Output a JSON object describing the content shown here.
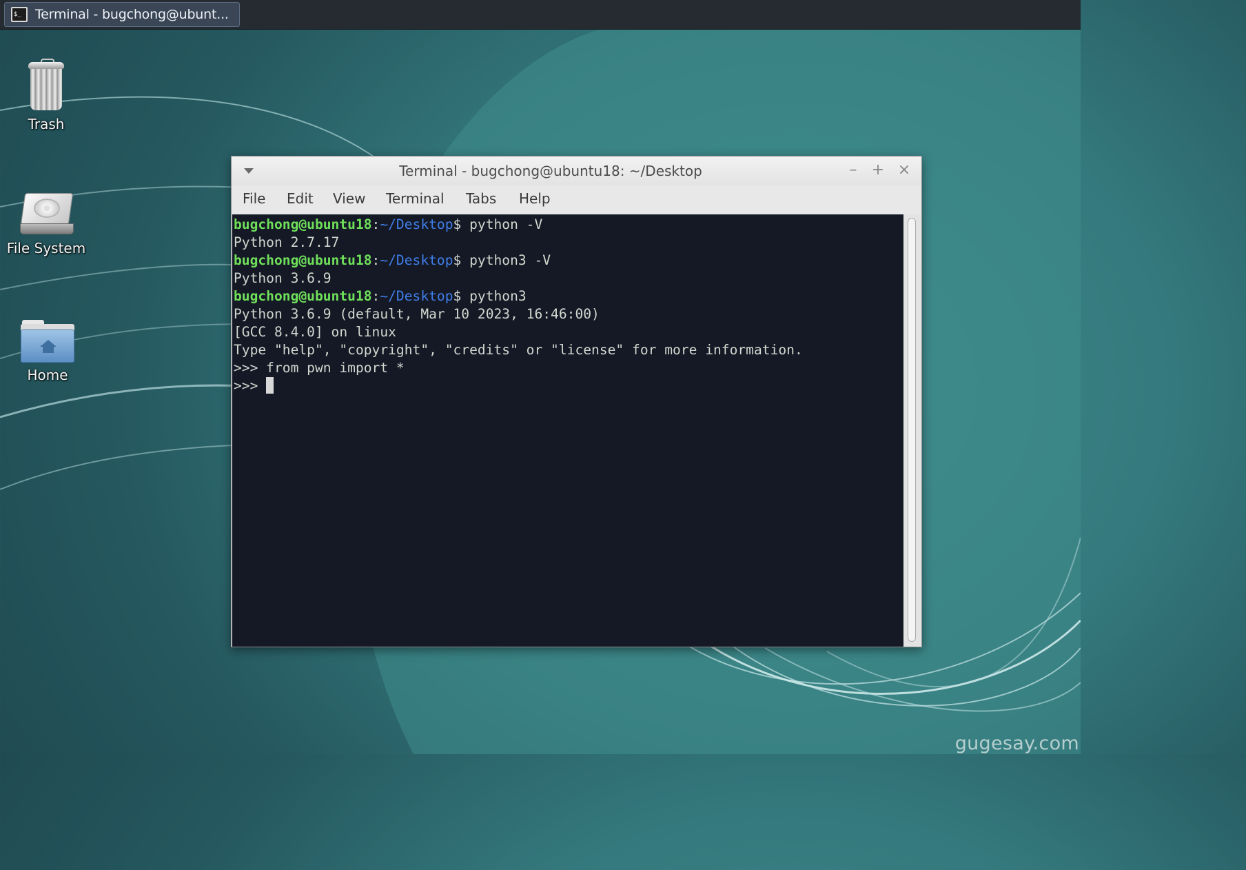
{
  "taskbar": {
    "window_button_label": "Terminal - bugchong@ubunt...",
    "window_icon": "terminal-icon"
  },
  "desktop": {
    "icons": [
      {
        "label": "Trash",
        "icon": "trash-icon"
      },
      {
        "label": "File System",
        "icon": "hard-drive-icon"
      },
      {
        "label": "Home",
        "icon": "home-folder-icon"
      }
    ]
  },
  "window": {
    "title": "Terminal - bugchong@ubuntu18: ~/Desktop",
    "controls": {
      "minimize": "–",
      "maximize": "+",
      "close": "×"
    },
    "menu": [
      "File",
      "Edit",
      "View",
      "Terminal",
      "Tabs",
      "Help"
    ]
  },
  "terminal": {
    "user_host": "bugchong@ubuntu18",
    "path": "~/Desktop",
    "lines": [
      {
        "type": "prompt",
        "command": "python -V"
      },
      {
        "type": "output",
        "text": "Python 2.7.17"
      },
      {
        "type": "prompt",
        "command": "python3 -V"
      },
      {
        "type": "output",
        "text": "Python 3.6.9"
      },
      {
        "type": "prompt",
        "command": "python3"
      },
      {
        "type": "output",
        "text": "Python 3.6.9 (default, Mar 10 2023, 16:46:00)"
      },
      {
        "type": "output",
        "text": "[GCC 8.4.0] on linux"
      },
      {
        "type": "output",
        "text": "Type \"help\", \"copyright\", \"credits\" or \"license\" for more information."
      },
      {
        "type": "output",
        "text": ">>> from pwn import *"
      },
      {
        "type": "cursor",
        "text": ">>> "
      }
    ]
  },
  "watermark": "gugesay.com"
}
